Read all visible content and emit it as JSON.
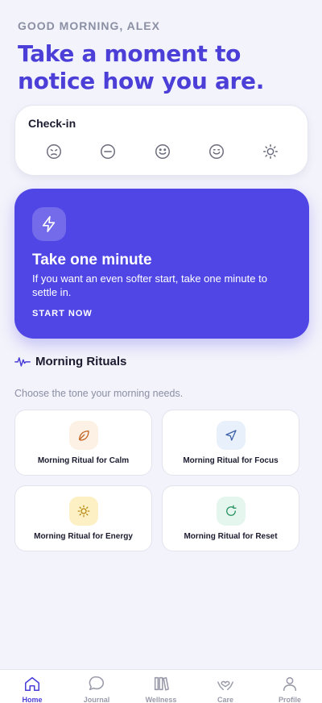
{
  "header": {
    "greeting": "GOOD MORNING, ALEX",
    "headline": "Take a moment to notice how you are."
  },
  "checkin": {
    "title": "Check-in",
    "moods": [
      "very-sad-face-icon",
      "neutral-minus-face-icon",
      "happy-face-icon",
      "smile-face-icon",
      "sun-icon"
    ]
  },
  "hero": {
    "icon": "lightning-icon",
    "title": "Take one minute",
    "text": "If you want an even softer start, take one minute to settle in.",
    "cta": "START NOW",
    "color": "#5046e5"
  },
  "rituals": {
    "title": "Morning Rituals",
    "subtitle": "Choose the tone your morning needs.",
    "items": [
      {
        "label": "Morning Ritual for Calm",
        "icon": "leaf-icon",
        "bg": "#fdf1e6",
        "fg": "#c2611f"
      },
      {
        "label": "Morning Ritual for Focus",
        "icon": "navigation-arrow-icon",
        "bg": "#e8f0fb",
        "fg": "#3a5fa8"
      },
      {
        "label": "Morning Ritual for Energy",
        "icon": "sun-icon",
        "bg": "#fdf0c4",
        "fg": "#b7860b"
      },
      {
        "label": "Morning Ritual for Reset",
        "icon": "refresh-icon",
        "bg": "#e5f6ee",
        "fg": "#1f8f5a"
      }
    ]
  },
  "tabs": [
    {
      "label": "Home",
      "icon": "home-icon",
      "active": true
    },
    {
      "label": "Journal",
      "icon": "chat-bubble-icon",
      "active": false
    },
    {
      "label": "Wellness",
      "icon": "library-icon",
      "active": false
    },
    {
      "label": "Care",
      "icon": "heart-hands-icon",
      "active": false
    },
    {
      "label": "Profile",
      "icon": "user-icon",
      "active": false
    }
  ],
  "colors": {
    "accent": "#4b3fd8",
    "muted": "#8b8fa3",
    "background": "#f3f3fb"
  }
}
